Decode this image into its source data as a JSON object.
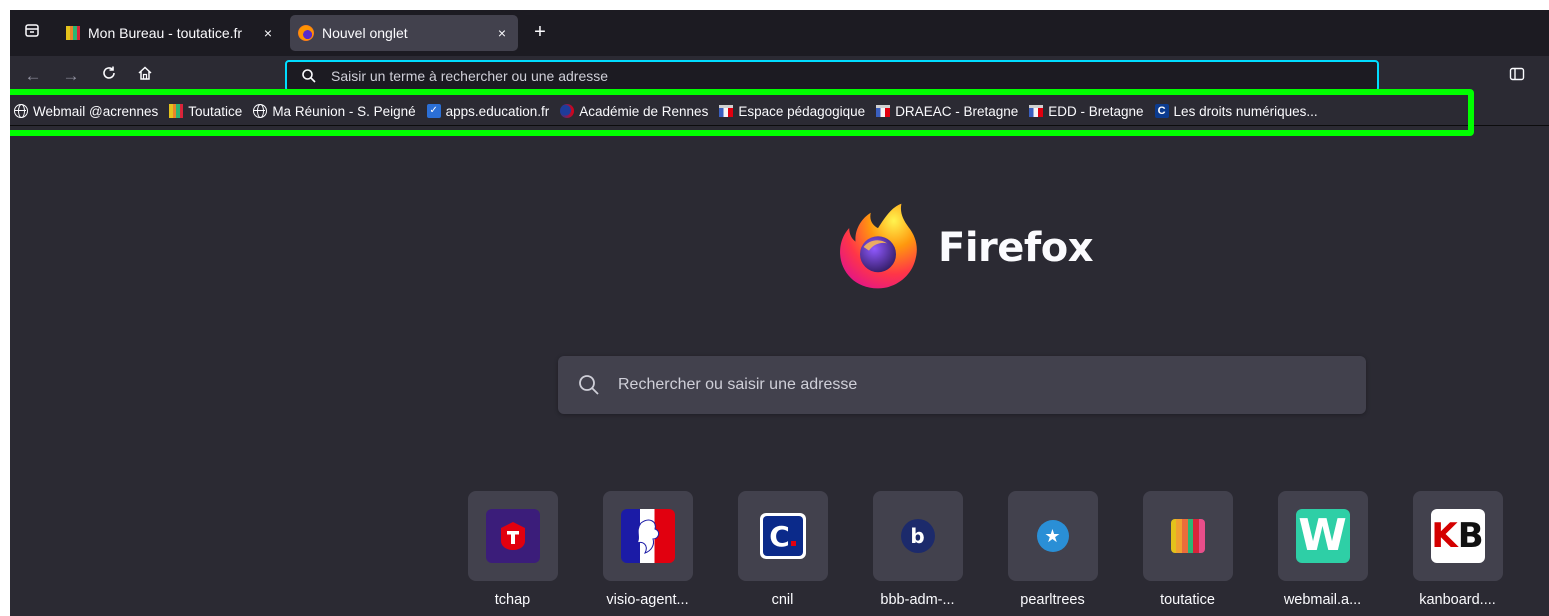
{
  "tabs": [
    {
      "title": "Mon Bureau - toutatice.fr",
      "close": "×",
      "favicon": "toutatice-stripes-icon",
      "active": false
    },
    {
      "title": "Nouvel onglet",
      "close": "×",
      "favicon": "firefox-icon",
      "active": true
    }
  ],
  "new_tab": "+",
  "nav": {
    "back": "←",
    "forward": "→",
    "reload": "↻",
    "home": "home-icon"
  },
  "urlbar": {
    "placeholder": "Saisir un terme à rechercher ou une adresse",
    "value": ""
  },
  "bookmarks": [
    {
      "label": "Webmail @acrennes",
      "icon": "globe-icon"
    },
    {
      "label": "Toutatice",
      "icon": "toutatice-stripes-icon"
    },
    {
      "label": "Ma Réunion - S. Peigné",
      "icon": "globe-icon"
    },
    {
      "label": "apps.education.fr",
      "icon": "apps-education-icon"
    },
    {
      "label": "Académie de Rennes",
      "icon": "academie-icon"
    },
    {
      "label": "Espace pédagogique",
      "icon": "marianne-icon"
    },
    {
      "label": "DRAEAC - Bretagne",
      "icon": "marianne-icon"
    },
    {
      "label": "EDD - Bretagne",
      "icon": "marianne-icon"
    },
    {
      "label": "Les droits numériques...",
      "icon": "cnil-icon"
    }
  ],
  "brand": {
    "name": "Firefox"
  },
  "home_search": {
    "placeholder": "Rechercher ou saisir une adresse"
  },
  "topsites": [
    {
      "label": "tchap",
      "icon": "tchap-icon"
    },
    {
      "label": "visio-agent...",
      "icon": "marianne-icon"
    },
    {
      "label": "cnil",
      "icon": "cnil-icon"
    },
    {
      "label": "bbb-adm-...",
      "icon": "bbb-icon"
    },
    {
      "label": "pearltrees",
      "icon": "pearltrees-icon"
    },
    {
      "label": "toutatice",
      "icon": "toutatice-stripes-icon"
    },
    {
      "label": "webmail.a...",
      "icon": "webmail-w-icon"
    },
    {
      "label": "kanboard....",
      "icon": "kanboard-icon"
    }
  ],
  "colors": {
    "chrome_dark": "#1c1b22",
    "chrome": "#2b2a33",
    "tile": "#42414d",
    "focus_ring": "#00ddff",
    "annotation_highlight": "#00ff00"
  }
}
